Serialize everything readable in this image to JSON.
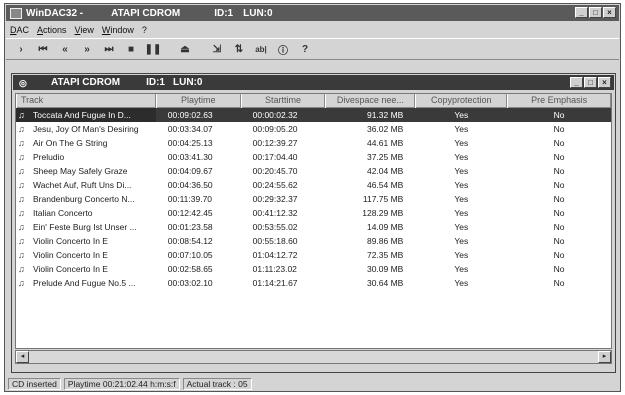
{
  "window": {
    "title_app": "WinDAC32 -",
    "title_drive": "ATAPI CDROM",
    "title_id": "ID:1",
    "title_lun": "LUN:0"
  },
  "menu": [
    "DAC",
    "Actions",
    "View",
    "Window",
    "?"
  ],
  "toolbar": {
    "icons": [
      "play-icon",
      "skip-back-icon",
      "rewind-icon",
      "fast-forward-icon",
      "skip-forward-icon",
      "stop-icon",
      "pause-icon",
      "eject-icon",
      "copy-icon",
      "copy-multi-icon",
      "rename-icon",
      "info-icon",
      "help-icon"
    ],
    "rename_label": "ab|"
  },
  "child": {
    "drive": "ATAPI CDROM",
    "id": "ID:1",
    "lun": "LUN:0"
  },
  "columns": [
    "Track",
    "Playtime",
    "Starttime",
    "Divespace nee...",
    "Copyprotection",
    "Pre Emphasis"
  ],
  "tracks": [
    {
      "track": "Toccata And Fugue In D...",
      "playtime": "00:09:02.63",
      "starttime": "00:00:02.32",
      "space": "91.32 MB",
      "copy": "Yes",
      "emph": "No"
    },
    {
      "track": "Jesu, Joy Of Man's Desiring",
      "playtime": "00:03:34.07",
      "starttime": "00:09:05.20",
      "space": "36.02 MB",
      "copy": "Yes",
      "emph": "No"
    },
    {
      "track": "Air On The G String",
      "playtime": "00:04:25.13",
      "starttime": "00:12:39.27",
      "space": "44.61 MB",
      "copy": "Yes",
      "emph": "No"
    },
    {
      "track": "Preludio",
      "playtime": "00:03:41.30",
      "starttime": "00:17:04.40",
      "space": "37.25 MB",
      "copy": "Yes",
      "emph": "No"
    },
    {
      "track": "Sheep May Safely Graze",
      "playtime": "00:04:09.67",
      "starttime": "00:20:45.70",
      "space": "42.04 MB",
      "copy": "Yes",
      "emph": "No"
    },
    {
      "track": "Wachet Auf, Ruft Uns Di...",
      "playtime": "00:04:36.50",
      "starttime": "00:24:55.62",
      "space": "46.54 MB",
      "copy": "Yes",
      "emph": "No"
    },
    {
      "track": "Brandenburg Concerto N...",
      "playtime": "00:11:39.70",
      "starttime": "00:29:32.37",
      "space": "117.75 MB",
      "copy": "Yes",
      "emph": "No"
    },
    {
      "track": "Italian Concerto",
      "playtime": "00:12:42.45",
      "starttime": "00:41:12.32",
      "space": "128.29 MB",
      "copy": "Yes",
      "emph": "No"
    },
    {
      "track": "Ein' Feste Burg Ist Unser ...",
      "playtime": "00:01:23.58",
      "starttime": "00:53:55.02",
      "space": "14.09 MB",
      "copy": "Yes",
      "emph": "No"
    },
    {
      "track": "Violin Concerto In E",
      "playtime": "00:08:54.12",
      "starttime": "00:55:18.60",
      "space": "89.86 MB",
      "copy": "Yes",
      "emph": "No"
    },
    {
      "track": "Violin Concerto In E",
      "playtime": "00:07:10.05",
      "starttime": "01:04:12.72",
      "space": "72.35 MB",
      "copy": "Yes",
      "emph": "No"
    },
    {
      "track": "Violin Concerto In E",
      "playtime": "00:02:58.65",
      "starttime": "01:11:23.02",
      "space": "30.09 MB",
      "copy": "Yes",
      "emph": "No"
    },
    {
      "track": "Prelude And Fugue No.5 ...",
      "playtime": "00:03:02.10",
      "starttime": "01:14:21.67",
      "space": "30.64 MB",
      "copy": "Yes",
      "emph": "No"
    }
  ],
  "status": {
    "cd": "CD inserted",
    "playtime": "Playtime 00:21:02.44 h:m:s:f",
    "track": "Actual track : 05"
  }
}
